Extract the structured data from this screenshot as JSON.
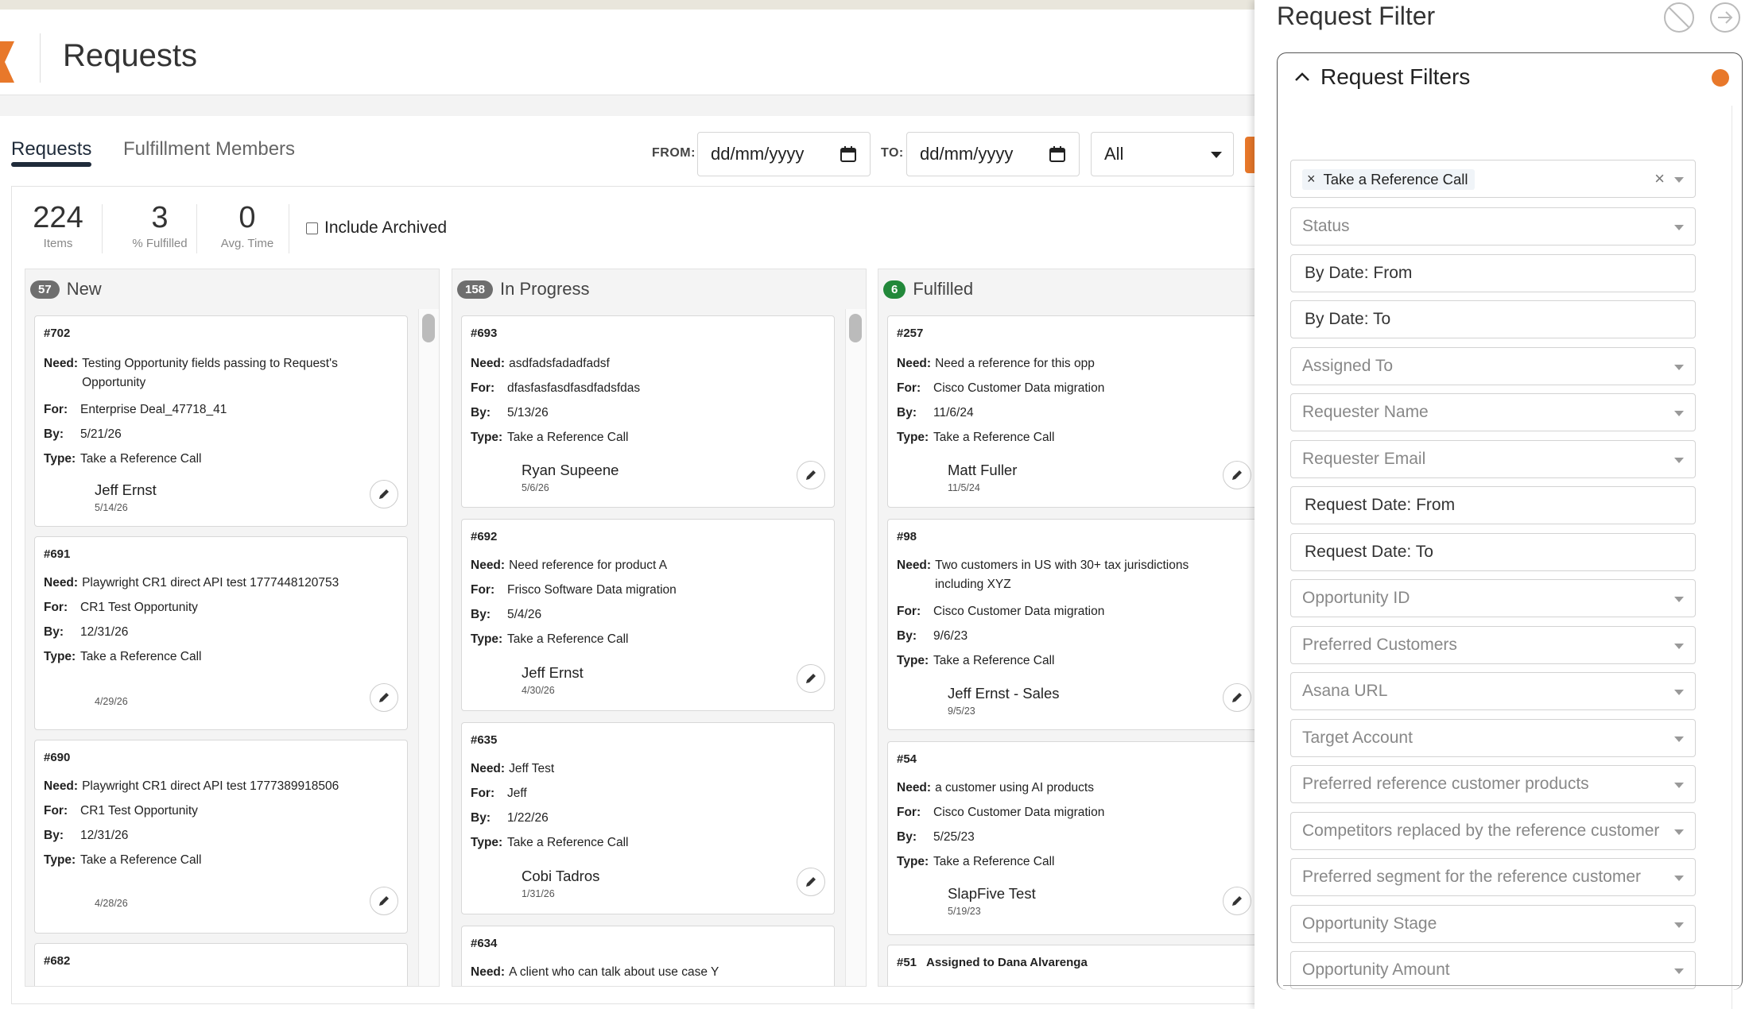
{
  "app": {
    "page_title": "Requests"
  },
  "tabs": [
    {
      "label": "Requests"
    },
    {
      "label": "Fulfillment Members"
    }
  ],
  "filters": {
    "from_label": "FROM:",
    "from_value": "dd/mm/yyyy",
    "to_label": "TO:",
    "to_value": "dd/mm/yyyy",
    "select_value": "All"
  },
  "stats": [
    {
      "value": "224",
      "label": "Items"
    },
    {
      "value": "3",
      "label": "% Fulfilled"
    },
    {
      "value": "0",
      "label": "Avg. Time"
    }
  ],
  "include_archived": "Include Archived",
  "columns": [
    {
      "count": "57",
      "title": "New",
      "cards": [
        {
          "id": "#702",
          "need": "Testing Opportunity fields passing to Request's Opportunity",
          "for": "Enterprise Deal_47718_41",
          "by": "5/21/26",
          "type": "Take a Reference Call",
          "person": "Jeff Ernst",
          "date": "5/14/26"
        },
        {
          "id": "#691",
          "need": "Playwright CR1 direct API test 1777448120753",
          "for": "CR1 Test Opportunity",
          "by": "12/31/26",
          "type": "Take a Reference Call",
          "person": "",
          "date": "4/29/26"
        },
        {
          "id": "#690",
          "need": "Playwright CR1 direct API test 1777389918506",
          "for": "CR1 Test Opportunity",
          "by": "12/31/26",
          "type": "Take a Reference Call",
          "person": "",
          "date": "4/28/26"
        },
        {
          "id": "#682"
        }
      ]
    },
    {
      "count": "158",
      "title": "In Progress",
      "cards": [
        {
          "id": "#693",
          "need": "asdfadsfadadfadsf",
          "for": "dfasfasfasdfasdfadsfdas",
          "by": "5/13/26",
          "type": "Take a Reference Call",
          "person": "Ryan Supeene",
          "date": "5/6/26"
        },
        {
          "id": "#692",
          "need": "Need reference for product A",
          "for": "Frisco Software Data migration",
          "by": "5/4/26",
          "type": "Take a Reference Call",
          "person": "Jeff Ernst",
          "date": "4/30/26"
        },
        {
          "id": "#635",
          "need": "Jeff Test",
          "for": "Jeff",
          "by": "1/22/26",
          "type": "Take a Reference Call",
          "person": "Cobi Tadros",
          "date": "1/31/26"
        },
        {
          "id": "#634",
          "need": "A client who can talk about use case Y"
        }
      ]
    },
    {
      "count": "6",
      "title": "Fulfilled",
      "cards": [
        {
          "id": "#257",
          "need": "Need a reference for this opp",
          "for": "Cisco Customer Data migration",
          "by": "11/6/24",
          "type": "Take a Reference Call",
          "person": "Matt Fuller",
          "date": "11/5/24"
        },
        {
          "id": "#98",
          "need": "Two customers in US with 30+ tax jurisdictions including XYZ",
          "for": "Cisco Customer Data migration",
          "by": "9/6/23",
          "type": "Take a Reference Call",
          "person": "Jeff Ernst - Sales",
          "date": "9/5/23"
        },
        {
          "id": "#54",
          "need": "a customer using AI products",
          "for": "Cisco Customer Data migration",
          "by": "5/25/23",
          "type": "Take a Reference Call",
          "person": "SlapFive Test",
          "date": "5/19/23"
        },
        {
          "id": "#51",
          "assigned": "Assigned to Dana Alvarenga"
        }
      ]
    }
  ],
  "field_labels": {
    "need": "Need:",
    "for": "For:",
    "by": "By:",
    "type": "Type:"
  },
  "panel": {
    "title": "Request Filter",
    "section_title": "Request Filters",
    "selected_chip": "Take a Reference Call",
    "fields": [
      {
        "label": "Status",
        "kind": "select"
      },
      {
        "label": "By Date: From",
        "kind": "text"
      },
      {
        "label": "By Date: To",
        "kind": "text"
      },
      {
        "label": "Assigned To",
        "kind": "select"
      },
      {
        "label": "Requester Name",
        "kind": "select"
      },
      {
        "label": "Requester Email",
        "kind": "select"
      },
      {
        "label": "Request Date: From",
        "kind": "text"
      },
      {
        "label": "Request Date: To",
        "kind": "text"
      },
      {
        "label": "Opportunity ID",
        "kind": "select"
      },
      {
        "label": "Preferred Customers",
        "kind": "select"
      },
      {
        "label": "Asana URL",
        "kind": "select"
      },
      {
        "label": "Target Account",
        "kind": "select"
      },
      {
        "label": "Preferred reference customer products",
        "kind": "select"
      },
      {
        "label": "Competitors replaced by the reference customer",
        "kind": "select"
      },
      {
        "label": "Preferred segment for the reference customer",
        "kind": "select"
      },
      {
        "label": "Opportunity Stage",
        "kind": "select"
      },
      {
        "label": "Opportunity Amount",
        "kind": "select"
      }
    ]
  },
  "colors": {
    "accent": "#e8782a",
    "dark": "#1f2b3a",
    "green": "#22883a"
  }
}
